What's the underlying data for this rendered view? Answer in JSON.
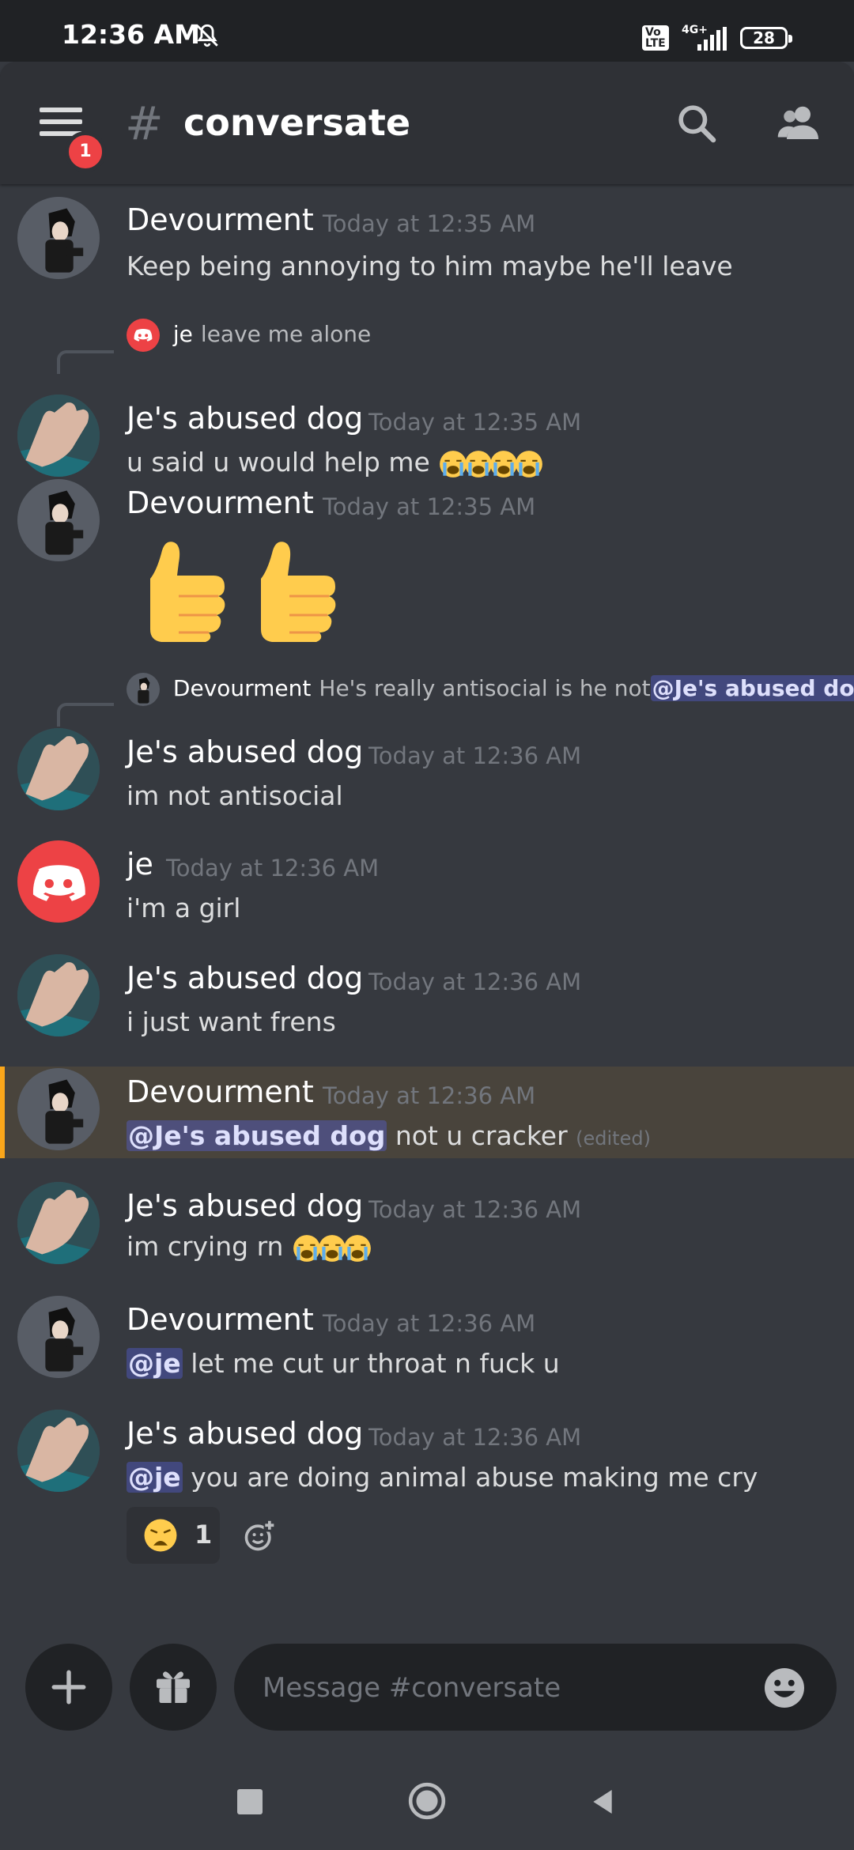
{
  "status_bar": {
    "time": "12:36 AM",
    "volte": "Vo\nLTE",
    "network": "4G+",
    "battery": "28"
  },
  "header": {
    "hash": "#",
    "channel": "conversate",
    "badge": "1"
  },
  "messages": [
    {
      "author": "Devourment",
      "time": "Today at 12:35 AM",
      "text": "Keep being annoying to him maybe he'll leave",
      "avatar": "devourment-avatar"
    },
    {
      "reply": {
        "name": "je",
        "text": "leave me alone"
      },
      "author": "Je's abused dog",
      "time": "Today at 12:35 AM",
      "text": "u said u would help me ",
      "emoji": "loudly-crying-face x4"
    },
    {
      "author": "Devourment",
      "time": "Today at 12:35 AM",
      "emoji": "thumbs-up x2"
    },
    {
      "reply": {
        "name": "Devourment",
        "text": "He's really antisocial is he not",
        "mention": "@Je's abused dog"
      },
      "author": "Je's abused dog",
      "time": "Today at 12:36 AM",
      "text": "im not antisocial"
    },
    {
      "author": "je",
      "time": "Today at 12:36 AM",
      "text": "i'm a girl"
    },
    {
      "author": "Je's abused dog",
      "time": "Today at 12:36 AM",
      "text": "i just want frens"
    },
    {
      "author": "Devourment",
      "time": "Today at 12:36 AM",
      "mention": "@Je's abused dog",
      "text": " not u cracker ",
      "edited": "(edited)"
    },
    {
      "author": "Je's abused dog",
      "time": "Today at 12:36 AM",
      "text": "im crying rn ",
      "emoji": "loudly-crying-face x3"
    },
    {
      "author": "Devourment",
      "time": "Today at 12:36 AM",
      "mention": "@je",
      "text": " let me cut ur throat n fuck u"
    },
    {
      "author": "Je's abused dog",
      "time": "Today at 12:36 AM",
      "mention": "@je",
      "text": "  you are doing animal abuse making me cry",
      "reaction": {
        "emoji": "weary-face",
        "count": "1"
      }
    }
  ],
  "composer": {
    "placeholder": "Message #conversate"
  },
  "colors": {
    "background": "#36393f",
    "header": "#2f3136",
    "mention_bg": "#5865f2",
    "highlight": "#faa61a",
    "badge": "#ed4245"
  }
}
